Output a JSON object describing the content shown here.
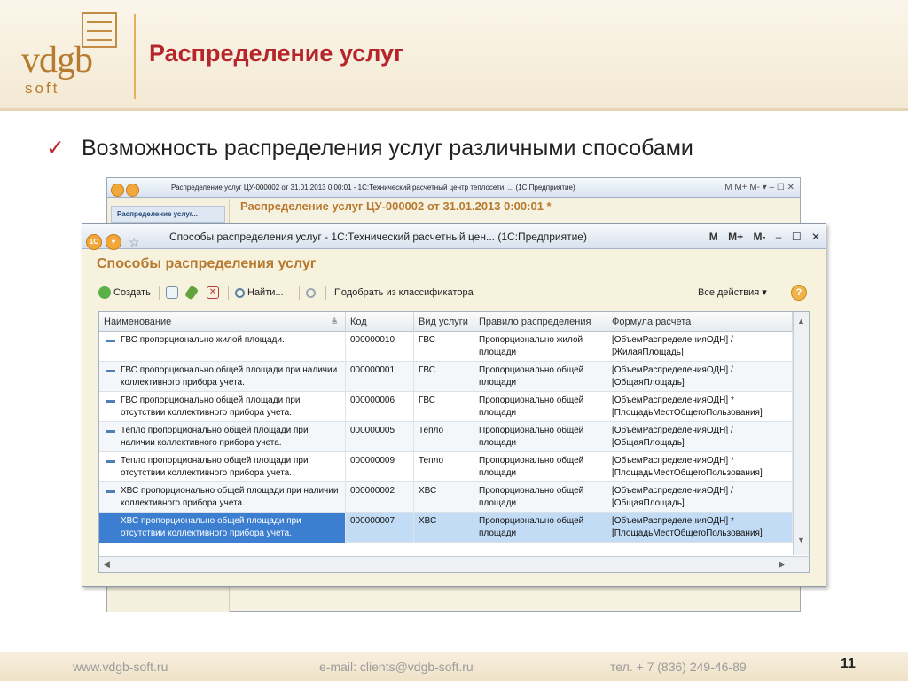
{
  "slide": {
    "logo_text": "vdgb",
    "logo_sub": "soft",
    "title": "Распределение услуг",
    "bullet_mark": "✓",
    "bullet_text": "Возможность распределения услуг различными способами"
  },
  "back_window": {
    "title": "Распределение услуг ЦУ-000002 от 31.01.2013 0:00:01 - 1С:Технический расчетный центр теплосети, ... (1С:Предприятие)",
    "controls": "M  M+  M-  ▾  –  ☐  ✕",
    "side_item": "Распределение услуг...",
    "heading": "Распределение услуг ЦУ-000002 от 31.01.2013 0:00:01 *"
  },
  "window": {
    "title": "Способы распределения услуг - 1С:Технический расчетный цен... (1С:Предприятие)",
    "ctrl_m": "M",
    "ctrl_mplus": "M+",
    "ctrl_mminus": "M-",
    "ctrl_min": "–",
    "ctrl_max": "☐",
    "ctrl_close": "✕",
    "form_title": "Способы распределения услуг",
    "toolbar": {
      "create": "Создать",
      "find": "Найти...",
      "pick": "Подобрать из классификатора",
      "all_actions": "Все действия ▾",
      "help": "?"
    },
    "columns": [
      "Наименование",
      "Код",
      "Вид услуги",
      "Правило распределения",
      "Формула расчета"
    ],
    "rows": [
      {
        "name": "ГВС пропорционально жилой площади.",
        "code": "000000010",
        "kind": "ГВС",
        "rule": "Пропорционально жилой площади",
        "formula": "[ОбъемРаспределенияОДН] / [ЖилаяПлощадь]"
      },
      {
        "name": "ГВС пропорционально общей площади при наличии коллективного прибора учета.",
        "code": "000000001",
        "kind": "ГВС",
        "rule": "Пропорционально общей площади",
        "formula": "[ОбъемРаспределенияОДН] / [ОбщаяПлощадь]"
      },
      {
        "name": "ГВС пропорционально общей площади при отсутствии коллективного прибора учета.",
        "code": "000000006",
        "kind": "ГВС",
        "rule": "Пропорционально общей площади",
        "formula": "[ОбъемРаспределенияОДН] * [ПлощадьМестОбщегоПользования]"
      },
      {
        "name": "Тепло пропорционально общей площади при наличии коллективного прибора учета.",
        "code": "000000005",
        "kind": "Тепло",
        "rule": "Пропорционально общей площади",
        "formula": "[ОбъемРаспределенияОДН] / [ОбщаяПлощадь]"
      },
      {
        "name": "Тепло пропорционально общей площади при отсутствии коллективного прибора учета.",
        "code": "000000009",
        "kind": "Тепло",
        "rule": "Пропорционально общей площади",
        "formula": "[ОбъемРаспределенияОДН] * [ПлощадьМестОбщегоПользования]"
      },
      {
        "name": "ХВС пропорционально общей площади при наличии коллективного прибора учета.",
        "code": "000000002",
        "kind": "ХВС",
        "rule": "Пропорционально общей площади",
        "formula": "[ОбъемРаспределенияОДН] / [ОбщаяПлощадь]"
      },
      {
        "name": "ХВС пропорционально общей площади при отсутствии коллективного прибора учета.",
        "code": "000000007",
        "kind": "ХВС",
        "rule": "Пропорционально общей площади",
        "formula": "[ОбъемРаспределенияОДН] * [ПлощадьМестОбщегоПользования]"
      }
    ],
    "selected_row": 6
  },
  "footer": {
    "site": "www.vdgb-soft.ru",
    "email": "e-mail: clients@vdgb-soft.ru",
    "phone": "тел. + 7 (836) 249-46-89",
    "page": "11"
  }
}
